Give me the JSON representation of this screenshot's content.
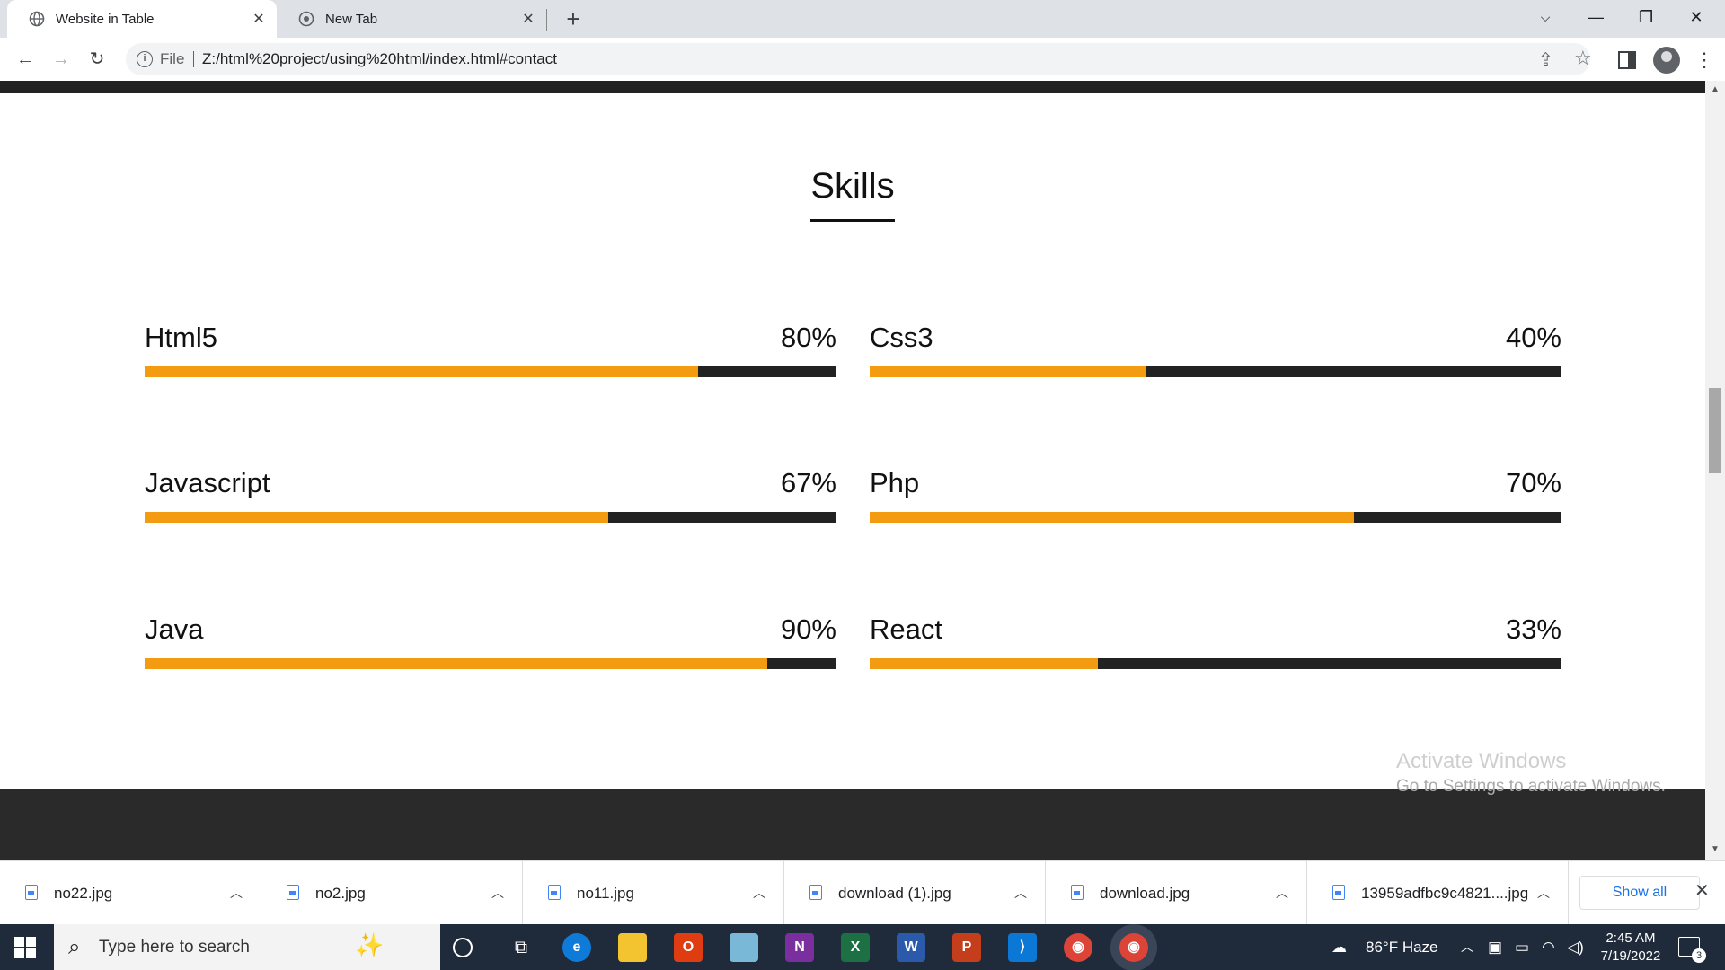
{
  "browser": {
    "tabs": [
      {
        "title": "Website in Table",
        "active": true
      },
      {
        "title": "New Tab",
        "active": false
      }
    ],
    "omnibox": {
      "scheme_label": "File",
      "url": "Z:/html%20project/using%20html/index.html#contact"
    }
  },
  "page": {
    "heading": "Skills",
    "skills": [
      {
        "name": "Html5",
        "percent_label": "80%",
        "level": 0.8
      },
      {
        "name": "Css3",
        "percent_label": "40%",
        "level": 0.4
      },
      {
        "name": "Javascript",
        "percent_label": "67%",
        "level": 0.67
      },
      {
        "name": "Php",
        "percent_label": "70%",
        "level": 0.7
      },
      {
        "name": "Java",
        "percent_label": "90%",
        "level": 0.9
      },
      {
        "name": "React",
        "percent_label": "33%",
        "level": 0.33
      }
    ],
    "watermark": {
      "title": "Activate Windows",
      "subtitle": "Go to Settings to activate Windows."
    }
  },
  "downloads": {
    "items": [
      "no22.jpg",
      "no2.jpg",
      "no11.jpg",
      "download (1).jpg",
      "download.jpg",
      "13959adfbc9c4821....jpg"
    ],
    "show_all": "Show all"
  },
  "taskbar": {
    "search_placeholder": "Type here to search",
    "weather": "86°F  Haze",
    "time": "2:45 AM",
    "date": "7/19/2022",
    "notification_count": "3"
  },
  "colors": {
    "bar_fill": "#f39c12",
    "bar_track": "#222222",
    "footer": "#2a2a2a",
    "taskbar": "#1f2a3a"
  }
}
